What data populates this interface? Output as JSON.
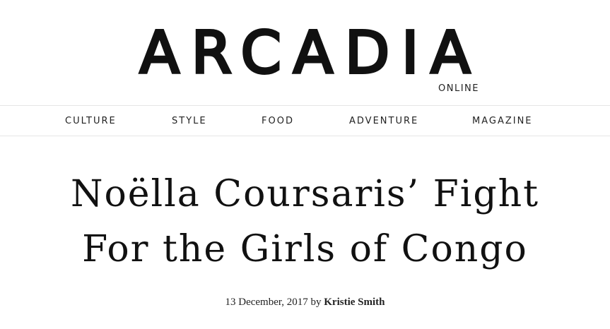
{
  "header": {
    "logo_text": "ARCADIA",
    "logo_subtext": "ONLINE"
  },
  "nav": {
    "items": [
      {
        "label": "CULTURE"
      },
      {
        "label": "STYLE"
      },
      {
        "label": "FOOD"
      },
      {
        "label": "ADVENTURE"
      },
      {
        "label": "MAGAZINE"
      }
    ]
  },
  "article": {
    "title_line1": "Noëlla Coursaris’ Fight",
    "title_line2": "For the Girls of Congo",
    "date": "13 December, 2017",
    "by_word": "by",
    "author": "Kristie Smith"
  },
  "colors": {
    "text": "#111111",
    "divider": "#e6e6e6",
    "background": "#ffffff"
  }
}
